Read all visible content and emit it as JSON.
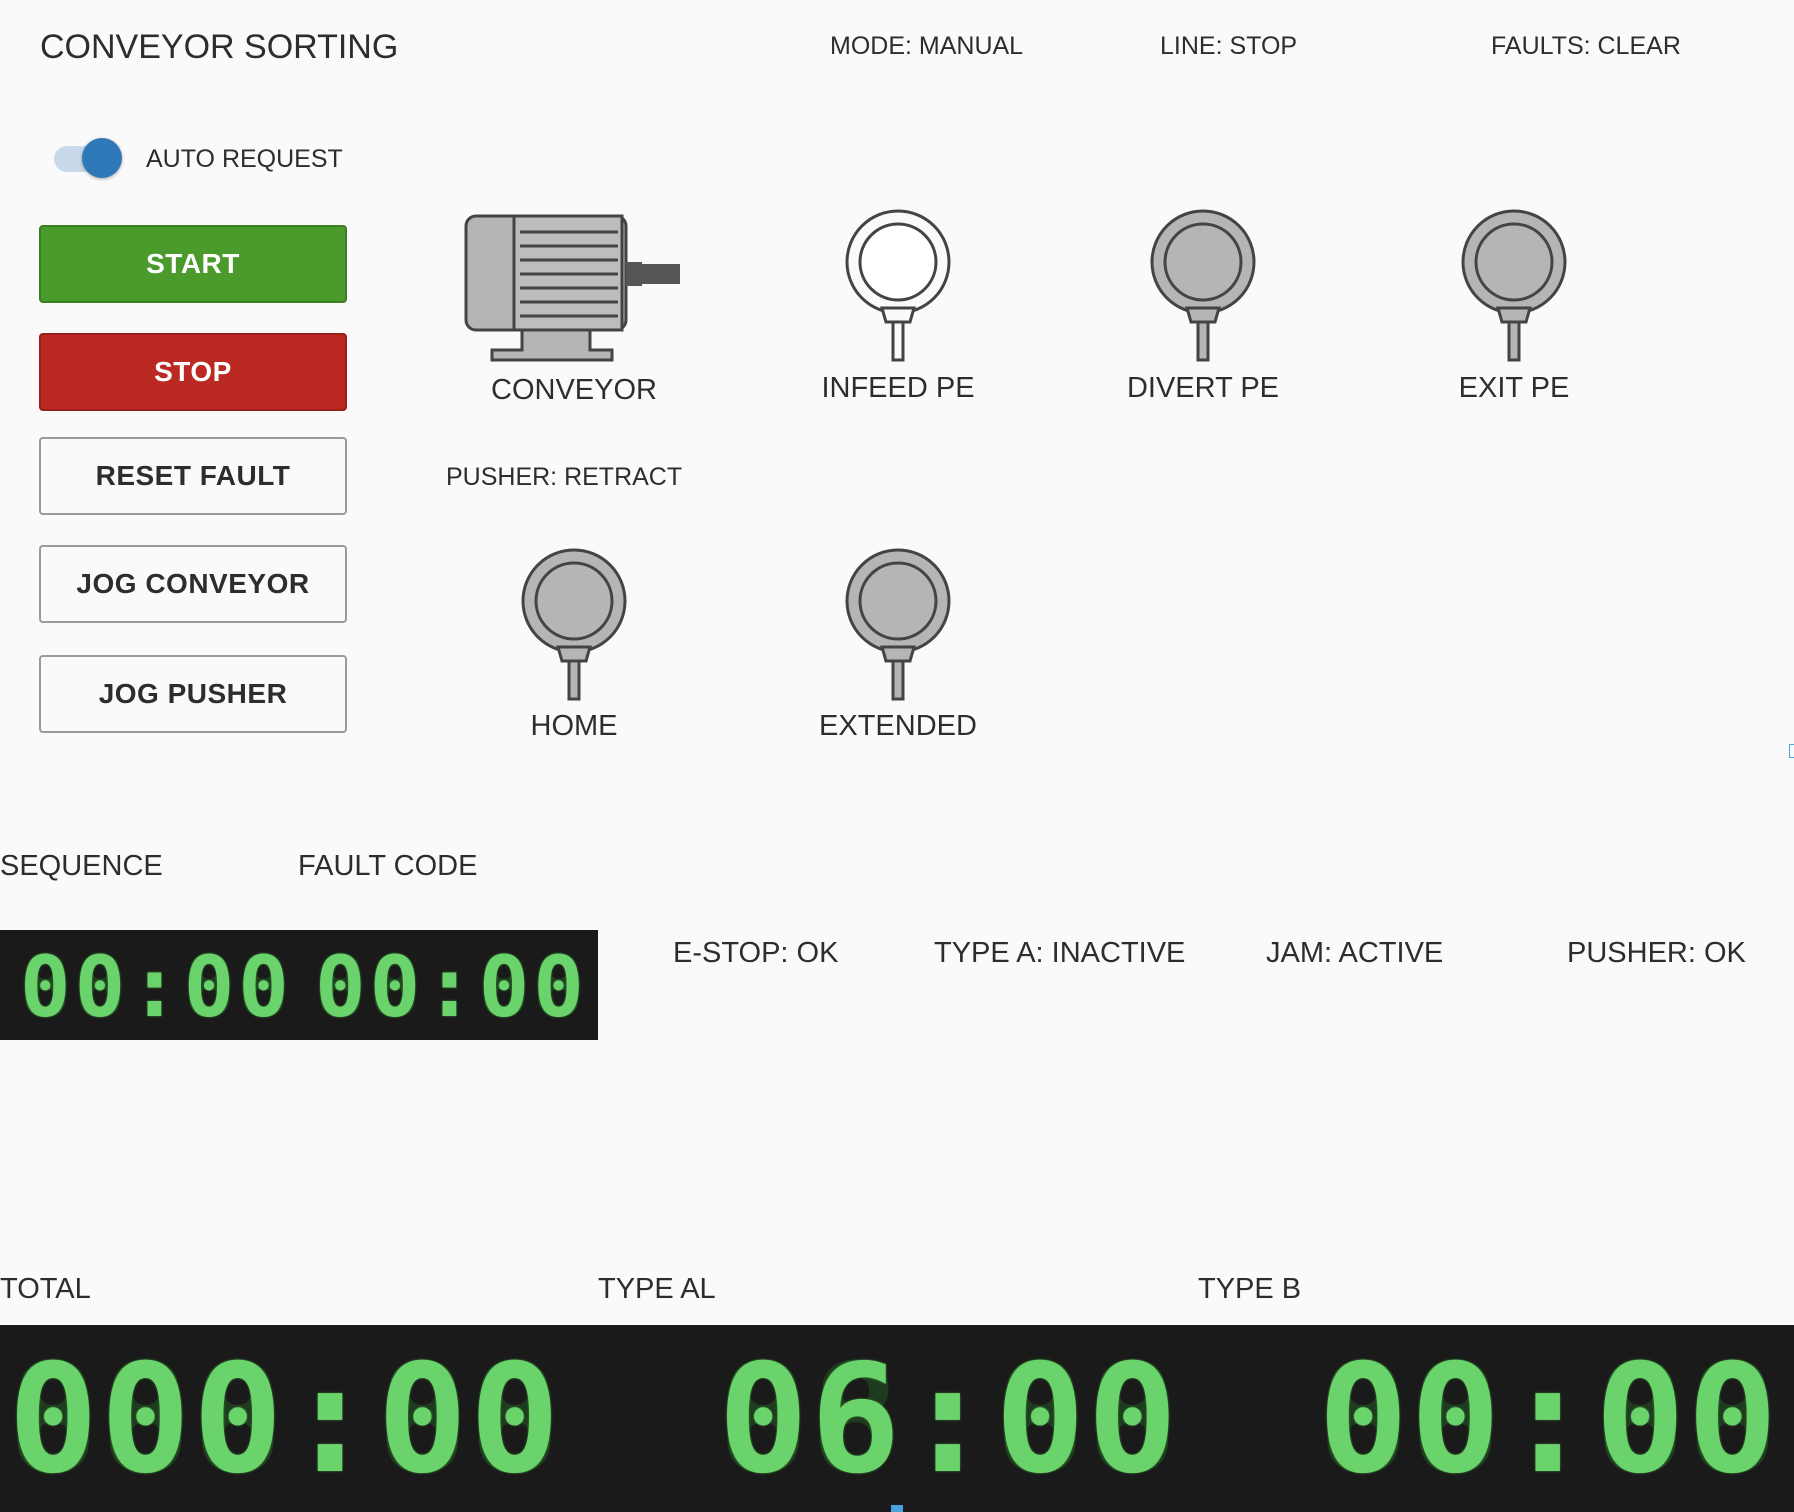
{
  "header": {
    "title": "CONVEYOR SORTING",
    "mode": "MODE: MANUAL",
    "line": "LINE: STOP",
    "faults": "FAULTS: CLEAR"
  },
  "auto_request": {
    "label": "AUTO REQUEST",
    "on": true
  },
  "buttons": {
    "start": "START",
    "stop": "STOP",
    "reset_fault": "RESET FAULT",
    "jog_conveyor": "JOG CONVEYOR",
    "jog_pusher": "JOG PUSHER"
  },
  "devices": {
    "conveyor": "CONVEYOR",
    "infeed_pe": "INFEED PE",
    "divert_pe": "DIVERT PE",
    "exit_pe": "EXIT PE",
    "home": "HOME",
    "extended": "EXTENDED"
  },
  "pusher_status": "PUSHER: RETRACT",
  "displays": {
    "sequence_label": "SEQUENCE",
    "fault_code_label": "FAULT CODE",
    "sequence_value": "00:00",
    "fault_code_value": "00:00",
    "total_label": "TOTAL",
    "type_al_label": "TYPE AL",
    "type_b_label": "TYPE B",
    "total_value": "000:00",
    "type_al_value": "06:00",
    "type_b_value": "00:00"
  },
  "status_flags": {
    "estop": "E-STOP: OK",
    "type_a": "TYPE A: INACTIVE",
    "jam": "JAM: ACTIVE",
    "pusher": "PUSHER: OK"
  },
  "colors": {
    "start": "#4a9b2c",
    "stop": "#ba2a22",
    "toggle": "#2f78b7",
    "lcd_on": "#6bd36b",
    "lcd_bg": "#1a1a1a"
  }
}
